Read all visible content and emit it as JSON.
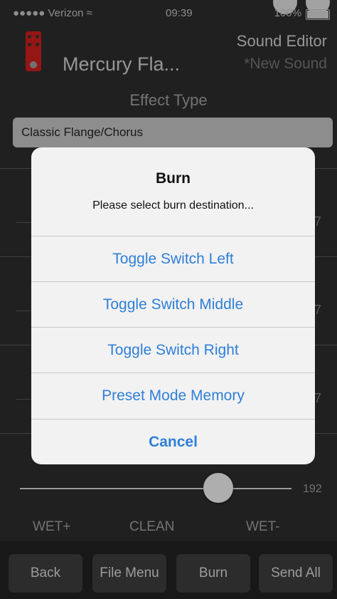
{
  "status_bar": {
    "carrier": "●●●●● Verizon ≈",
    "time": "09:39",
    "battery": "100%"
  },
  "header": {
    "pedal_name": "Mercury Fla...",
    "sound_editor": "Sound Editor",
    "new_sound": "*New Sound"
  },
  "effect": {
    "label": "Effect Type",
    "selected": "Classic Flange/Chorus"
  },
  "background_values": [
    "7",
    "7",
    "7"
  ],
  "slider": {
    "value": "192"
  },
  "modes": [
    "WET+",
    "CLEAN",
    "WET-"
  ],
  "toolbar": {
    "back": "Back",
    "file_menu": "File Menu",
    "burn": "Burn",
    "send_all": "Send All"
  },
  "dialog": {
    "title": "Burn",
    "message": "Please select burn destination...",
    "options": [
      "Toggle Switch Left",
      "Toggle Switch Middle",
      "Toggle Switch Right",
      "Preset Mode Memory"
    ],
    "cancel": "Cancel"
  },
  "colors": {
    "accent": "#2f7fd8",
    "pedal": "#c81c1c",
    "background": "#2b2b2b"
  }
}
